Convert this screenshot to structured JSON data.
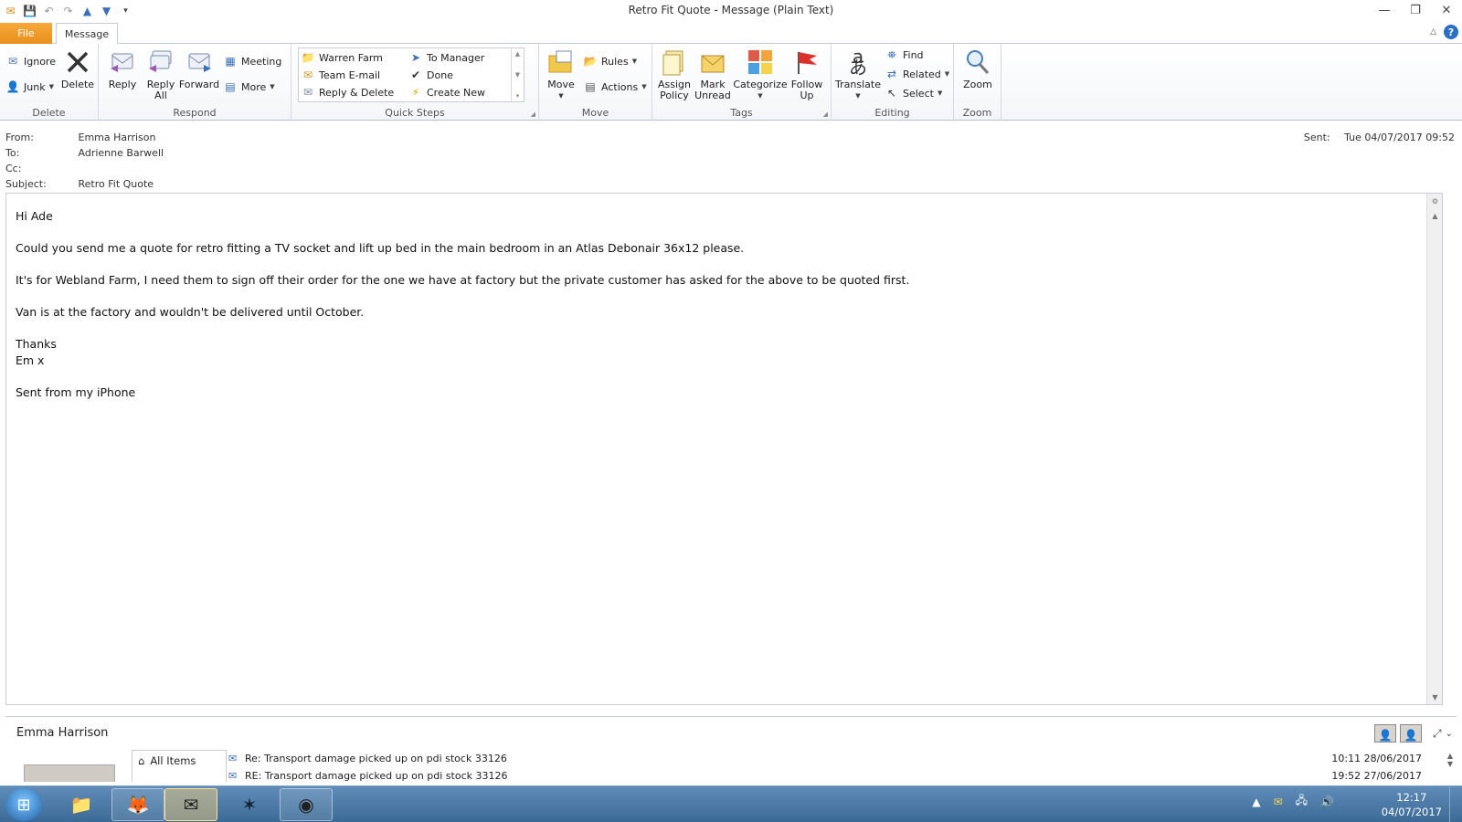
{
  "window": {
    "title": "Retro Fit Quote  -  Message (Plain Text)"
  },
  "tabs": {
    "file": "File",
    "message": "Message"
  },
  "ribbon": {
    "delete_group": {
      "label": "Delete",
      "ignore": "Ignore",
      "junk": "Junk",
      "delete": "Delete"
    },
    "respond_group": {
      "label": "Respond",
      "reply": "Reply",
      "reply_all_1": "Reply",
      "reply_all_2": "All",
      "forward": "Forward",
      "meeting": "Meeting",
      "more": "More"
    },
    "quicksteps_group": {
      "label": "Quick Steps",
      "items": [
        "Warren Farm",
        "Team E-mail",
        "Reply & Delete",
        "To Manager",
        "Done",
        "Create New"
      ]
    },
    "move_group": {
      "label": "Move",
      "move": "Move",
      "rules": "Rules",
      "actions": "Actions"
    },
    "tags_group": {
      "label": "Tags",
      "assign_policy_1": "Assign",
      "assign_policy_2": "Policy",
      "mark_unread_1": "Mark",
      "mark_unread_2": "Unread",
      "categorize": "Categorize",
      "follow_up_1": "Follow",
      "follow_up_2": "Up"
    },
    "editing_group": {
      "label": "Editing",
      "translate": "Translate",
      "find": "Find",
      "related": "Related",
      "select": "Select"
    },
    "zoom_group": {
      "label": "Zoom",
      "zoom": "Zoom"
    }
  },
  "header": {
    "from_label": "From:",
    "from_value": "Emma Harrison",
    "to_label": "To:",
    "to_value": "Adrienne Barwell",
    "cc_label": "Cc:",
    "cc_value": "",
    "subject_label": "Subject:",
    "subject_value": "Retro Fit Quote",
    "sent_label": "Sent:",
    "sent_value": "Tue 04/07/2017 09:52"
  },
  "body": {
    "greeting": "Hi Ade",
    "line1": "Could you send me a quote for retro fitting a TV socket and lift up bed in the main bedroom in an Atlas Debonair 36x12 please.",
    "line2": "It's for Webland Farm, I need them to sign off their order for the one we have at factory but the private customer has asked for the above to be quoted first.",
    "line3": "Van is at the factory and wouldn't be delivered until October.",
    "signoff1": "Thanks",
    "signoff2": "Em x",
    "signature": "Sent from my iPhone"
  },
  "people_pane": {
    "name": "Emma Harrison",
    "nav_item": "All Items",
    "rows": [
      {
        "subject": "Re: Transport damage picked up on pdi stock 33126",
        "date": "10:11  28/06/2017"
      },
      {
        "subject": "RE: Transport damage picked up on pdi stock 33126",
        "date": "19:52  27/06/2017"
      }
    ]
  },
  "taskbar": {
    "time": "12:17",
    "date": "04/07/2017"
  },
  "colors": {
    "file_tab": "#e8901d",
    "taskbar": "#3c6a97",
    "help": "#2a6fc4"
  }
}
